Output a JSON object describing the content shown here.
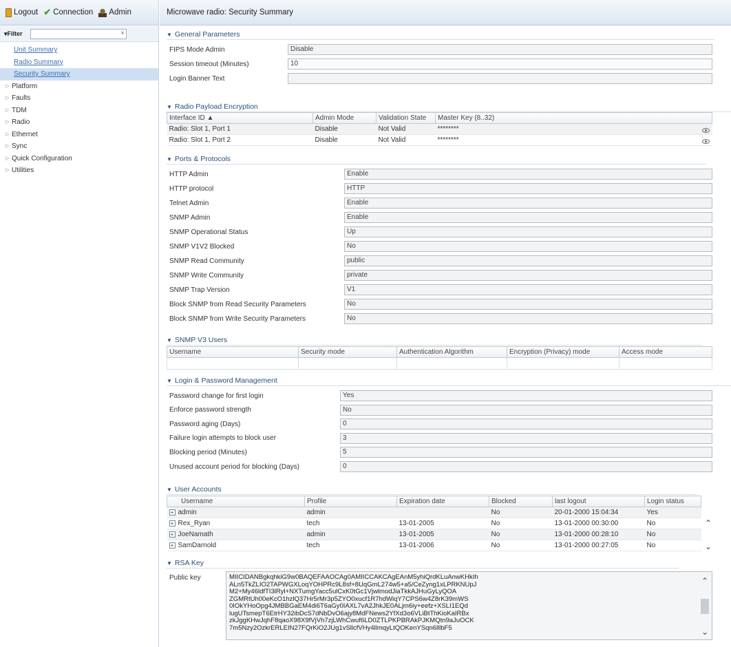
{
  "toolbar": {
    "logout_label": "Logout",
    "connection_label": "Connection",
    "admin_label": "Admin"
  },
  "filter": {
    "label": "Filter",
    "value": "",
    "clear_symbol": "×"
  },
  "sidebar": {
    "links": [
      "Unit Summary",
      "Radio Summary",
      "Security Summary"
    ],
    "folders": [
      "Platform",
      "Faults",
      "TDM",
      "Radio",
      "Ethernet",
      "Sync",
      "Quick Configuration",
      "Utilities"
    ]
  },
  "page_title": "Microwave radio: Security Summary",
  "general": {
    "title": "General Parameters",
    "fields": [
      {
        "label": "FIPS Mode Admin",
        "value": "Disable"
      },
      {
        "label": "Session timeout (Minutes)",
        "value": "10"
      },
      {
        "label": "Login Banner Text",
        "value": ""
      }
    ]
  },
  "payload": {
    "title": "Radio Payload Encryption",
    "headers": [
      "Interface ID ▲",
      "Admin Mode",
      "Validation State",
      "Master Key (8..32)"
    ],
    "rows": [
      [
        "Radio: Slot 1, Port 1",
        "Disable",
        "Not Valid",
        "********"
      ],
      [
        "Radio: Slot 1, Port 2",
        "Disable",
        "Not Valid",
        "********"
      ]
    ]
  },
  "ports": {
    "title": "Ports & Protocols",
    "fields": [
      {
        "label": "HTTP Admin",
        "value": "Enable"
      },
      {
        "label": "HTTP protocol",
        "value": "HTTP"
      },
      {
        "label": "Telnet Admin",
        "value": "Enable"
      },
      {
        "label": "SNMP Admin",
        "value": "Enable"
      },
      {
        "label": "SNMP Operational Status",
        "value": "Up"
      },
      {
        "label": "SNMP V1V2 Blocked",
        "value": "No"
      },
      {
        "label": "SNMP Read Community",
        "value": "public"
      },
      {
        "label": "SNMP Write Community",
        "value": "private"
      },
      {
        "label": "SNMP Trap Version",
        "value": "V1"
      },
      {
        "label": "Block SNMP from Read Security Parameters",
        "value": "No"
      },
      {
        "label": "Block SNMP from Write Security Parameters",
        "value": "No"
      }
    ]
  },
  "snmpv3": {
    "title": "SNMP V3 Users",
    "headers": [
      "Username",
      "Security mode",
      "Authentication Algorithm",
      "Encryption (Privacy) mode",
      "Access mode"
    ]
  },
  "login": {
    "title": "Login & Password Management",
    "fields": [
      {
        "label": "Password change for first login",
        "value": "Yes"
      },
      {
        "label": "Enforce password strength",
        "value": "No"
      },
      {
        "label": "Password aging (Days)",
        "value": "0"
      },
      {
        "label": "Failure login attempts to block user",
        "value": "3"
      },
      {
        "label": "Blocking period (Minutes)",
        "value": "5"
      },
      {
        "label": "Unused account period for blocking (Days)",
        "value": "0"
      }
    ]
  },
  "users": {
    "title": "User Accounts",
    "headers": [
      "Username",
      "Profile",
      "Expiration date",
      "Blocked",
      "last logout",
      "Login status"
    ],
    "rows": [
      [
        "admin",
        "admin",
        "",
        "No",
        "20-01-2000 15:04:34",
        "Yes"
      ],
      [
        "Rex_Ryan",
        "tech",
        "13-01-2005",
        "No",
        "13-01-2000 00:30:00",
        "No"
      ],
      [
        "JoeNamath",
        "admin",
        "13-01-2005",
        "No",
        "13-01-2000 00:28:10",
        "No"
      ],
      [
        "SamDarnold",
        "tech",
        "13-01-2006",
        "No",
        "13-01-2000 00:27:05",
        "No"
      ]
    ]
  },
  "rsa": {
    "title": "RSA Key",
    "label": "Public key",
    "lines": [
      "MIICIDANBgkqhkiG9w0BAQEFAAOCAg0AMIICCAKCAgEAnM5yhiQrdKLuAnwKHkIh",
      "ALn5TkZLIO2TAPWGXLoqYOHPRc9L8sf+8UqGmL274w5+a5/CeZyng1xLPRKNUpJ",
      "M2+My46ldfTI3lRyl+NXTumgYacc5ulCxK0tGc1VjwlmodJiaTkkAJHuGyLyQOA",
      "ZGMRtUh00eKcO1hzlQ37Hr5rMr3p5ZYO0xucf1R7hdWiqY7CPS6w4Z8rK39mWS",
      "0IOkYHoOpg4JMBBGaEM4di6T6aGy0IAXL7vA2JhkJE0ALjm6iy+eefz+XSLI1EQd",
      "lugUTsmepT6EtrHY32ibDcS7dNbDvO6ajy8MdFNews2YfXd3o6VLiBtThKioKaIRBx",
      "zkJggKHwJqhF8qaoX98X9fVjVh7zjLWhCwuf6LD0ZTLPKPBRAkPJKMQtn9aJuOCK",
      "7m5Nzy2OzkrERLEIN27FQrKiO2JUg1vSllcfVHy4llmqyLtQOKenYSqn6lllbF5"
    ]
  },
  "colors": {
    "link": "#3a6fb5",
    "section": "#2c4e78",
    "header_bg": "#dde7f2",
    "selected": "#cfe0f4"
  }
}
